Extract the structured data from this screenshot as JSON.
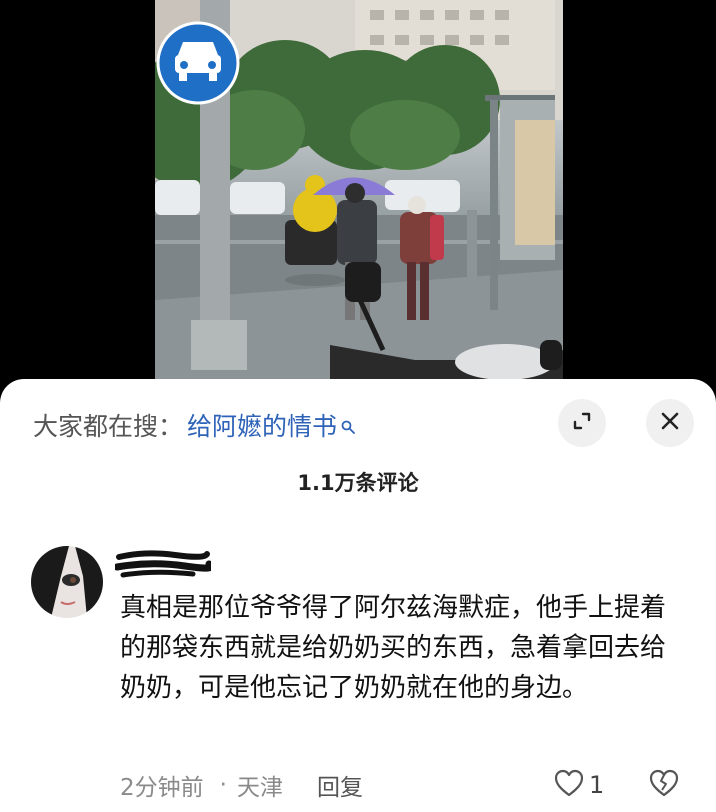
{
  "video": {
    "description_icon": "car-lane-sign-icon"
  },
  "search": {
    "prefix": "大家都在搜：",
    "term": "给阿嬷的情书"
  },
  "comments": {
    "count_label": "1.1万条评论"
  },
  "comment": {
    "text": "真相是那位爷爷得了阿尔兹海默症，他手上提着的那袋东西就是给奶奶买的东西，急着拿回去给奶奶，可是他忘记了奶奶就在他的身边。",
    "time": "2分钟前",
    "separator": "·",
    "location": "天津",
    "reply_label": "回复",
    "like_count": "1"
  },
  "colors": {
    "link": "#2f63b8",
    "sign_blue": "#1f6fc7",
    "umbrella": "#8a7bd6"
  }
}
